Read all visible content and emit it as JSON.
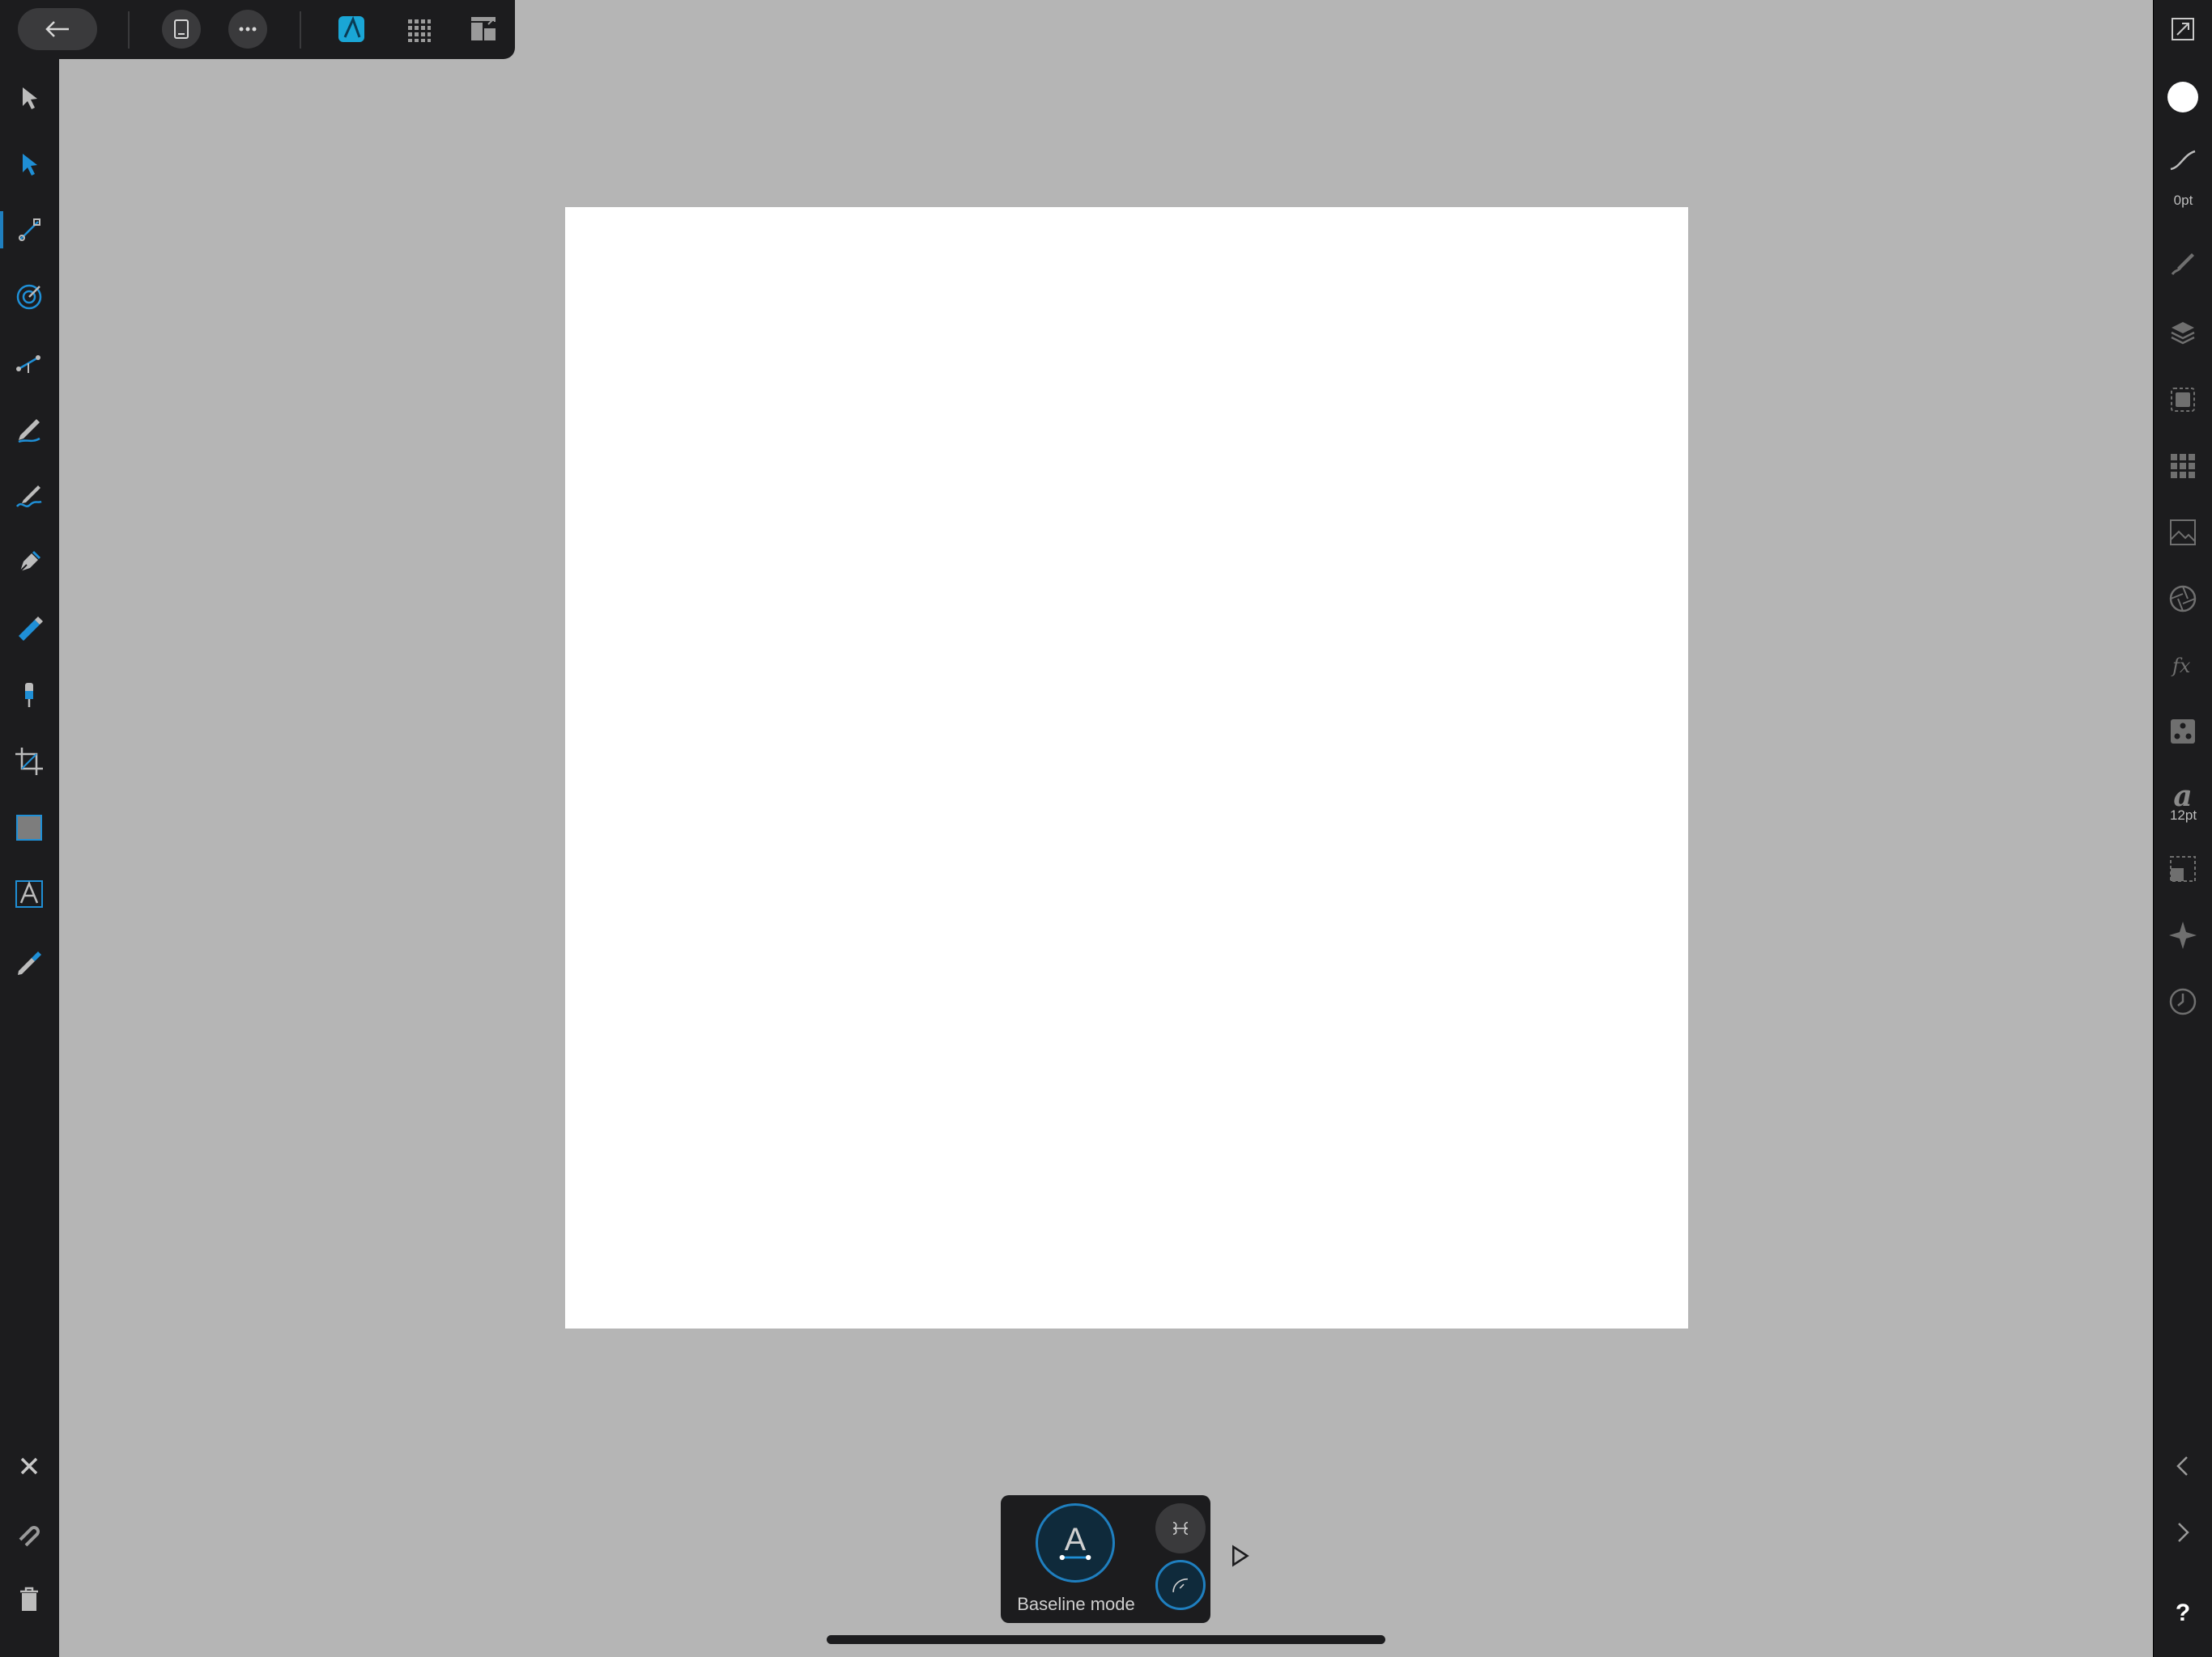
{
  "topbar": {
    "back": "back-arrow-icon",
    "document": "document-icon",
    "more": "more-icon",
    "persona": "designer-persona-icon",
    "pixel": "pixel-persona-icon",
    "export": "export-persona-icon"
  },
  "left_tools": [
    "move-tool-icon",
    "node-tool-icon",
    "corner-tool-icon",
    "point-transform-tool-icon",
    "vector-crop-icon",
    "pencil-tool-icon",
    "vector-brush-tool-icon",
    "pen-tool-icon",
    "fill-tool-icon",
    "transparency-tool-icon",
    "crop-tool-icon",
    "rectangle-tool-icon",
    "artistic-text-tool-icon",
    "color-picker-tool-icon"
  ],
  "left_bottom": [
    "close-icon",
    "snapping-icon",
    "delete-icon"
  ],
  "right_panel": {
    "stroke_label": "0pt",
    "text_label": "12pt",
    "text_glyph": "a",
    "help_glyph": "?",
    "fill_color": "#ffffff",
    "accent_color": "#1f7fbf"
  },
  "context": {
    "mode_label": "Baseline mode",
    "main_glyph": "A"
  }
}
